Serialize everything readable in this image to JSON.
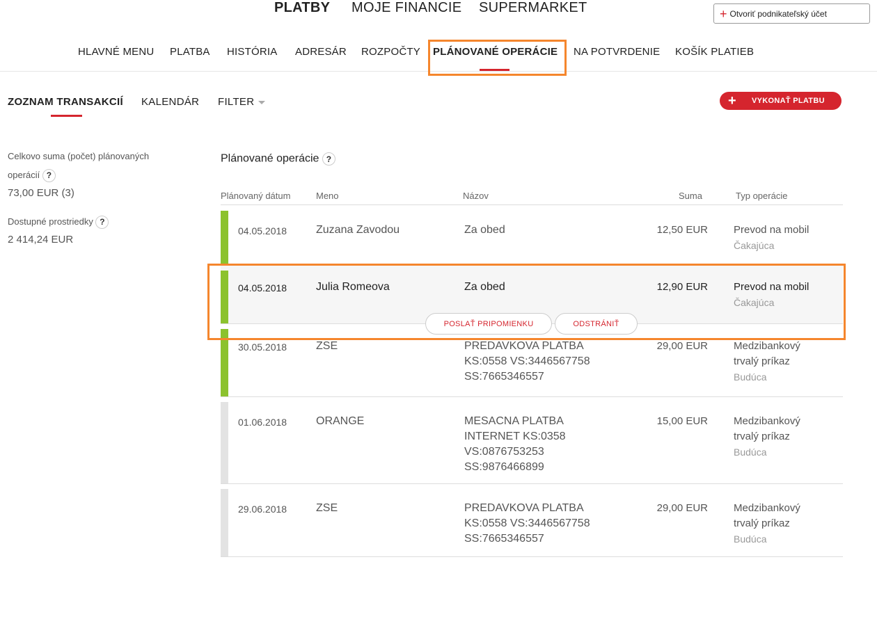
{
  "header": {
    "main_tabs": [
      "PLATBY",
      "MOJE FINANCIE",
      "SUPERMARKET"
    ],
    "open_account_label": "Otvoriť podnikateľský účet",
    "sub_tabs": [
      "HLAVNÉ MENU",
      "PLATBA",
      "HISTÓRIA",
      "ADRESÁR",
      "ROZPOČTY",
      "PLÁNOVANÉ OPERÁCIE",
      "NA POTVRDENIE",
      "KOŠÍK PLATIEB"
    ],
    "active_main": "PLATBY",
    "active_sub": "PLÁNOVANÉ OPERÁCIE"
  },
  "view_tabs": {
    "list": "ZOZNAM TRANSAKCIÍ",
    "calendar": "KALENDÁR",
    "filter": "FILTER"
  },
  "pay_button": "VYKONAŤ PLATBU",
  "summary": {
    "total_label_line1": "Celkovo suma (počet) plánovaných",
    "total_label_line2": "operácií",
    "total_value": "73,00 EUR (3)",
    "available_label": "Dostupné prostriedky",
    "available_value": "2 414,24 EUR",
    "help": "?"
  },
  "table": {
    "title": "Plánované operácie",
    "columns": {
      "date": "Plánovaný dátum",
      "name": "Meno",
      "title": "Názov",
      "sum": "Suma",
      "type": "Typ operácie"
    },
    "rows": [
      {
        "date": "04.05.2018",
        "name": "Zuzana Zavodou",
        "title": [
          "Za obed"
        ],
        "sum": "12,50 EUR",
        "type": [
          "Prevod na mobil"
        ],
        "status": "Čakajúca"
      },
      {
        "date": "04.05.2018",
        "name": "Julia Romeova",
        "title": [
          "Za obed"
        ],
        "sum": "12,90 EUR",
        "type": [
          "Prevod na mobil"
        ],
        "status": "Čakajúca"
      },
      {
        "date": "30.05.2018",
        "name": "ZSE",
        "title": [
          "PREDAVKOVA PLATBA",
          "KS:0558 VS:3446567758",
          "SS:7665346557"
        ],
        "sum": "29,00 EUR",
        "type": [
          "Medzibankový",
          "trvalý príkaz"
        ],
        "status": "Budúca"
      },
      {
        "date": "01.06.2018",
        "name": "ORANGE",
        "title": [
          "MESACNA PLATBA",
          "INTERNET KS:0358",
          "VS:0876753253",
          "SS:9876466899"
        ],
        "sum": "15,00 EUR",
        "type": [
          "Medzibankový",
          "trvalý príkaz"
        ],
        "status": "Budúca"
      },
      {
        "date": "29.06.2018",
        "name": "ZSE",
        "title": [
          "PREDAVKOVA PLATBA",
          "KS:0558 VS:3446567758",
          "SS:7665346557"
        ],
        "sum": "29,00 EUR",
        "type": [
          "Medzibankový",
          "trvalý príkaz"
        ],
        "status": "Budúca"
      }
    ],
    "row_actions": {
      "remind": "POSLAŤ PRIPOMIENKU",
      "delete": "ODSTRÁNIŤ"
    }
  },
  "colors": {
    "accent": "#d5252e",
    "highlight": "#f5862d",
    "bar_active": "#8cc22e",
    "bar_inactive": "#e3e3e3"
  }
}
